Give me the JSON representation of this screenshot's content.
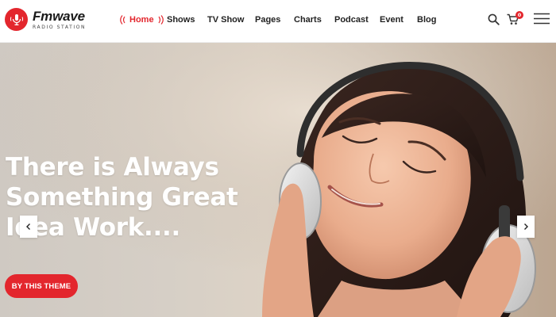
{
  "brand": {
    "name": "Fmwave",
    "tagline": "RADIO STATION",
    "accent_color": "#e3262d"
  },
  "nav": {
    "items": [
      {
        "label": "Home",
        "active": true
      },
      {
        "label": "Shows",
        "active": false
      },
      {
        "label": "TV Show",
        "active": false
      },
      {
        "label": "Pages",
        "active": false
      },
      {
        "label": "Charts",
        "active": false
      },
      {
        "label": "Podcast",
        "active": false
      },
      {
        "label": "Event",
        "active": false
      },
      {
        "label": "Blog",
        "active": false
      }
    ]
  },
  "header_actions": {
    "search_icon": "search-icon",
    "cart_icon": "cart-icon",
    "cart_count": "0",
    "menu_icon": "hamburger-menu-icon"
  },
  "hero": {
    "title_lines": [
      "There is Always",
      "Something Great",
      "Idea Work...."
    ],
    "cta_label": "BY THIS THEME",
    "prev_icon": "chevron-left-icon",
    "next_icon": "chevron-right-icon"
  }
}
